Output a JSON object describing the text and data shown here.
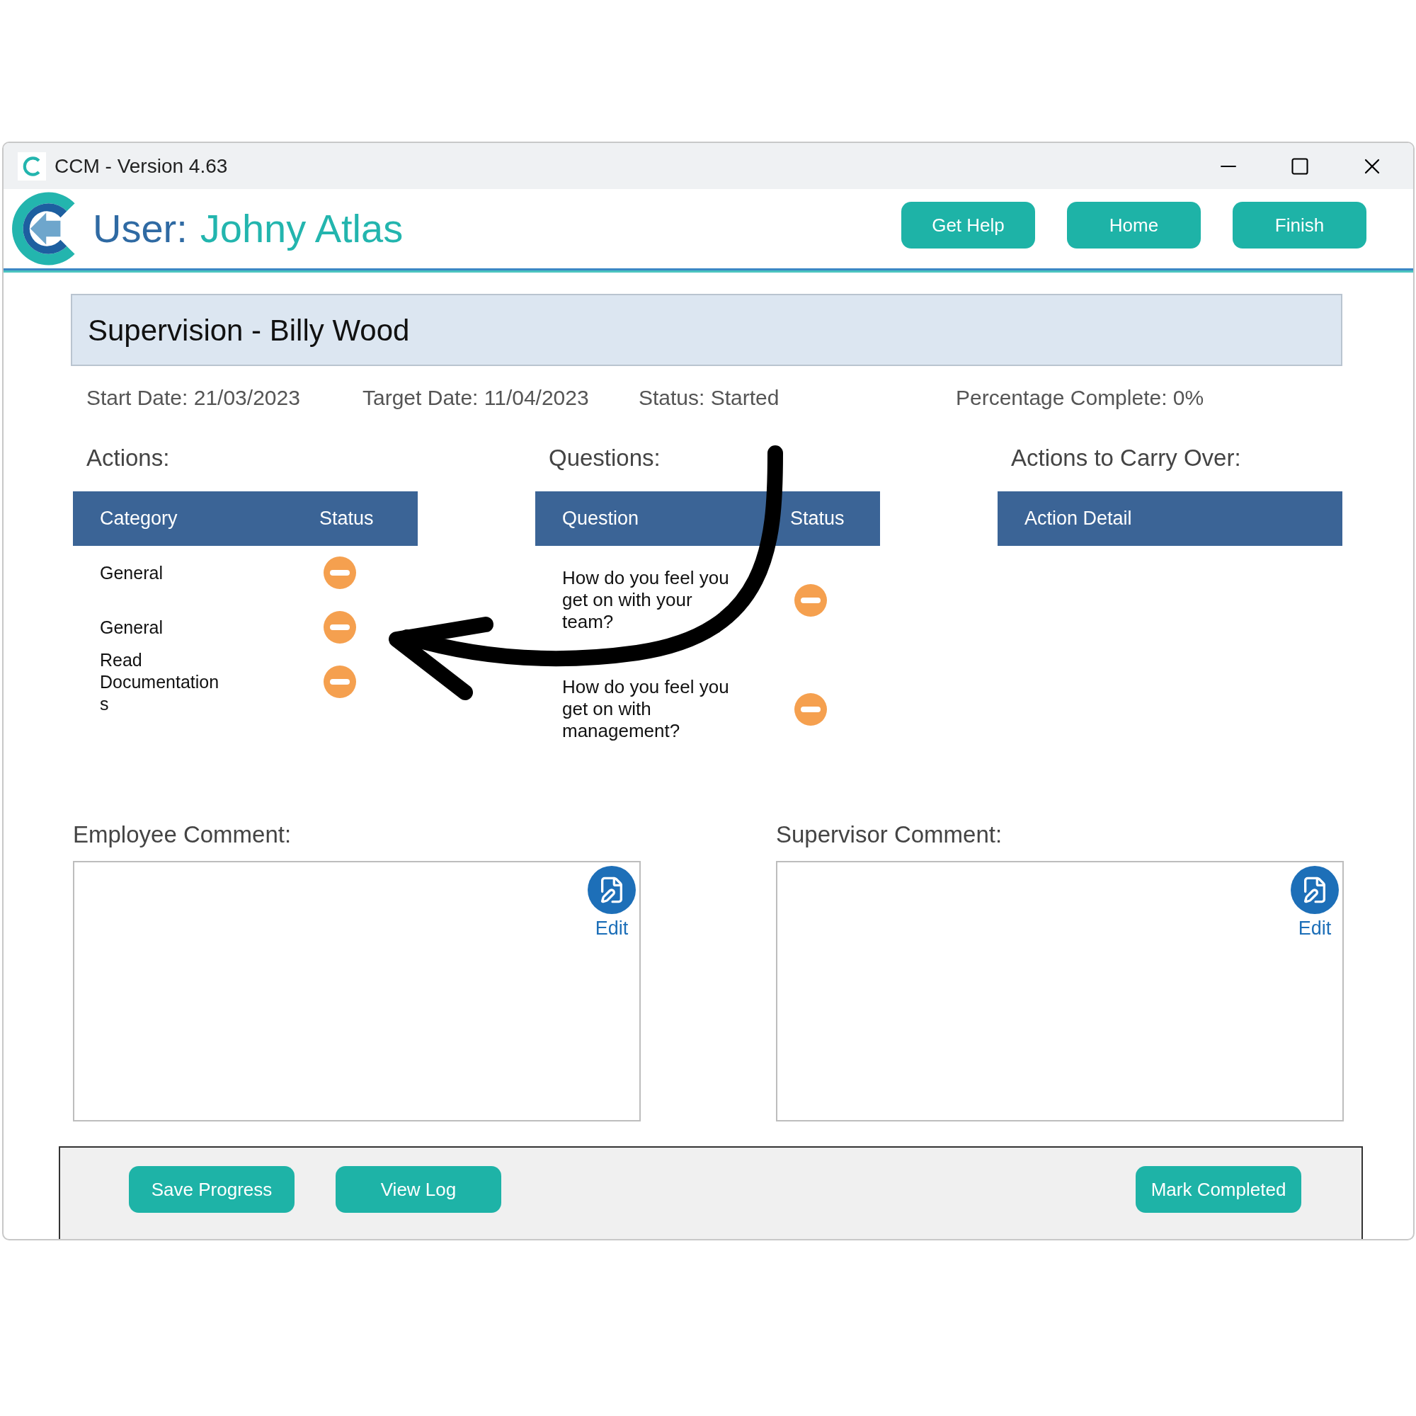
{
  "window": {
    "title": "CCM - Version 4.63"
  },
  "header": {
    "user_label": "User:",
    "user_name": "Johny Atlas",
    "buttons": [
      "Get Help",
      "Home",
      "Finish"
    ]
  },
  "banner": {
    "title": "Supervision - Billy Wood"
  },
  "info": [
    "Start Date: 21/03/2023",
    "Target Date: 11/04/2023",
    "Status: Started",
    "Percentage Complete: 0%"
  ],
  "actions": {
    "title": "Actions:",
    "columns": [
      "Category",
      "Status"
    ],
    "rows": [
      {
        "category": "General",
        "kind": "pending"
      },
      {
        "category": "General",
        "kind": "pending"
      },
      {
        "category": "Read Documentations",
        "kind": "pending"
      }
    ]
  },
  "questions": {
    "title": "Questions:",
    "columns": [
      "Question",
      "Status"
    ],
    "rows": [
      {
        "question": "How do you feel you get on with your team?",
        "kind": "pending"
      },
      {
        "question": "How do you feel you get on with management?",
        "kind": "pending"
      }
    ]
  },
  "carry_over": {
    "title": "Actions to Carry Over:",
    "columns": [
      "Action Detail"
    ]
  },
  "comments": [
    {
      "label": "Employee Comment:",
      "edit": "Edit"
    },
    {
      "label": "Supervisor Comment:",
      "edit": "Edit"
    }
  ],
  "footer": {
    "left_buttons": [
      "Save Progress",
      "View Log"
    ],
    "right_buttons": [
      "Mark Completed"
    ]
  }
}
